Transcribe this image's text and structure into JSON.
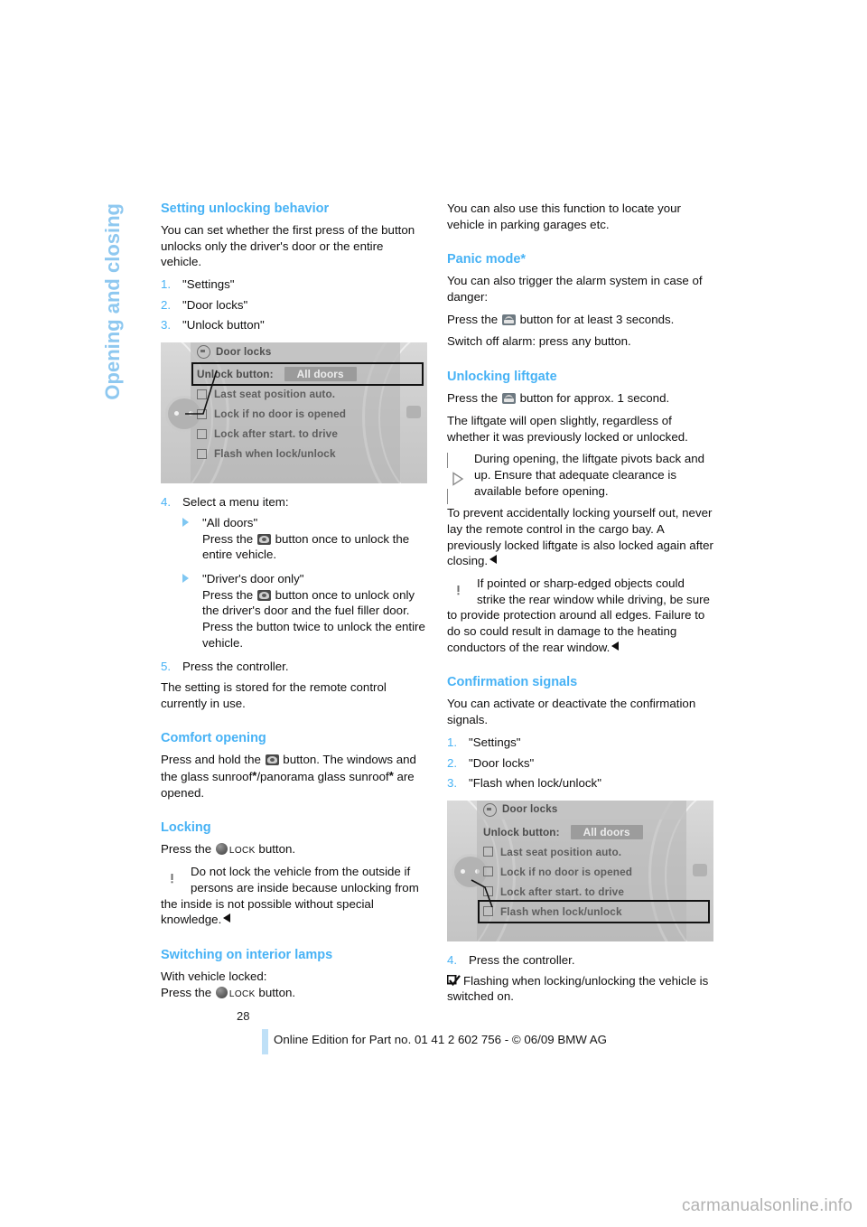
{
  "chapter": {
    "title": "Opening and closing"
  },
  "page": {
    "number": "28",
    "legal": "Online Edition for Part no. 01 41 2 602 756 - © 06/09 BMW AG",
    "watermark": "carmanualsonline.info"
  },
  "colors": {
    "heading": "#47b2f5",
    "heading_light": "#7fc7f2",
    "accent_bar": "#bfe0f7",
    "text": "#100f0f"
  },
  "left": {
    "s1": {
      "heading": "Setting unlocking behavior",
      "intro": "You can set whether the first press of the button unlocks only the driver's door or the entire vehicle.",
      "steps": [
        {
          "num": "1.",
          "text": "\"Settings\""
        },
        {
          "num": "2.",
          "text": "\"Door locks\""
        },
        {
          "num": "3.",
          "text": "\"Unlock button\""
        }
      ],
      "step4_num": "4.",
      "step4": "Select a menu item:",
      "sub1_title": "\"All doors\"",
      "sub1_a": "Press the",
      "sub1_b": "button once to unlock the entire vehicle.",
      "sub2_title": "\"Driver's door only\"",
      "sub2_a": "Press the",
      "sub2_b": "button once to unlock only the driver's door and the fuel filler door. Press the button twice to unlock the entire vehicle.",
      "step5_num": "5.",
      "step5": "Press the controller.",
      "after": "The setting is stored for the remote control currently in use."
    },
    "s2": {
      "heading": "Comfort opening",
      "a": "Press and hold the",
      "b": "button. The windows and the glass sunroof",
      "star1": "*",
      "c": "/panorama glass sunroof",
      "star2": "*",
      "d": " are opened."
    },
    "s3": {
      "heading": "Locking",
      "press_a": "Press the",
      "lock_word": "Lock",
      "press_b": "button.",
      "warning": "Do not lock the vehicle from the outside if persons are inside because unlocking from the inside is not possible without special knowledge."
    },
    "s4": {
      "heading": "Switching on interior lamps",
      "line1": "With vehicle locked:",
      "press_a": "Press the",
      "lock_word": "Lock",
      "press_b": "button."
    }
  },
  "right": {
    "intro": "You can also use this function to locate your vehicle in parking garages etc.",
    "s1": {
      "heading": "Panic mode*",
      "a": "You can also trigger the alarm system in case of danger:",
      "b1": "Press the",
      "b2": "button for at least 3 seconds.",
      "c": "Switch off alarm: press any button."
    },
    "s2": {
      "heading": "Unlocking liftgate",
      "a1": "Press the",
      "a2": "button for approx. 1 second.",
      "b": "The liftgate will open slightly, regardless of whether it was previously locked or unlocked.",
      "note": "During opening, the liftgate pivots back and up. Ensure that adequate clearance is available before opening.",
      "note2": "To prevent accidentally locking yourself out, never lay the remote control in the cargo bay. A previously locked liftgate is also locked again after closing.",
      "warning": "If pointed or sharp-edged objects could strike the rear window while driving, be sure to provide protection around all edges. Failure to do so could result in damage to the heating conductors of the rear window."
    },
    "s3": {
      "heading": "Confirmation signals",
      "intro": "You can activate or deactivate the confirmation signals.",
      "steps": [
        {
          "num": "1.",
          "text": "\"Settings\""
        },
        {
          "num": "2.",
          "text": "\"Door locks\""
        },
        {
          "num": "3.",
          "text": "\"Flash when lock/unlock\""
        }
      ],
      "step4_num": "4.",
      "step4": "Press the controller.",
      "result": "Flashing when locking/unlocking the vehicle is switched on."
    }
  },
  "idrive1": {
    "title": "Door locks",
    "head_label": "Unlock button:",
    "head_value": "All doors",
    "items": [
      "Last seat position auto.",
      "Lock if no door is opened",
      "Lock after start. to drive",
      "Flash when lock/unlock"
    ],
    "selected": "head"
  },
  "idrive2": {
    "title": "Door locks",
    "head_label": "Unlock button:",
    "head_value": "All doors",
    "items": [
      "Last seat position auto.",
      "Lock if no door is opened",
      "Lock after start. to drive",
      "Flash when lock/unlock"
    ],
    "selected": "item3"
  }
}
